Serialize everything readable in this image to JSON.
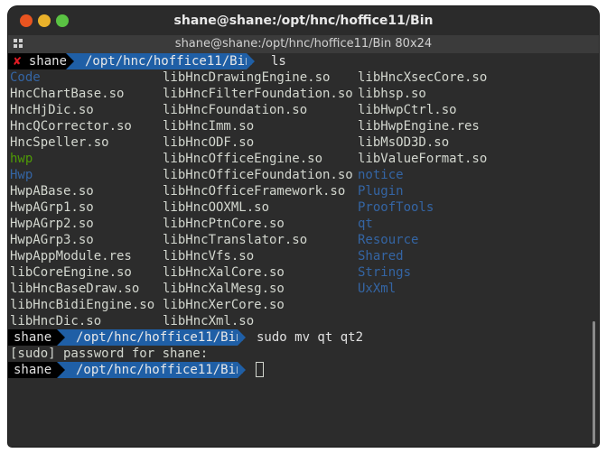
{
  "window": {
    "title": "shane@shane:/opt/hnc/hoffice11/Bin"
  },
  "tab": {
    "title": "shane@shane:/opt/hnc/hoffice11/Bin 80x24"
  },
  "prompt": {
    "user": "shane",
    "error_mark": "✘",
    "path": "/opt/hnc/hoffice11/Bin"
  },
  "commands": {
    "first": "ls",
    "second": "sudo mv qt qt2"
  },
  "sudo_prompt": "[sudo] password for shane:",
  "ls": {
    "col1": [
      {
        "name": "Code",
        "type": "dir"
      },
      {
        "name": "HncChartBase.so",
        "type": "file"
      },
      {
        "name": "HncHjDic.so",
        "type": "file"
      },
      {
        "name": "HncQCorrector.so",
        "type": "file"
      },
      {
        "name": "HncSpeller.so",
        "type": "file"
      },
      {
        "name": "hwp",
        "type": "exec"
      },
      {
        "name": "Hwp",
        "type": "dir"
      },
      {
        "name": "HwpABase.so",
        "type": "file"
      },
      {
        "name": "HwpAGrp1.so",
        "type": "file"
      },
      {
        "name": "HwpAGrp2.so",
        "type": "file"
      },
      {
        "name": "HwpAGrp3.so",
        "type": "file"
      },
      {
        "name": "HwpAppModule.res",
        "type": "file"
      },
      {
        "name": "libCoreEngine.so",
        "type": "file"
      },
      {
        "name": "libHncBaseDraw.so",
        "type": "file"
      },
      {
        "name": "libHncBidiEngine.so",
        "type": "file"
      },
      {
        "name": "libHncDic.so",
        "type": "file"
      }
    ],
    "col2": [
      {
        "name": "libHncDrawingEngine.so",
        "type": "file"
      },
      {
        "name": "libHncFilterFoundation.so",
        "type": "file"
      },
      {
        "name": "libHncFoundation.so",
        "type": "file"
      },
      {
        "name": "libHncImm.so",
        "type": "file"
      },
      {
        "name": "libHncODF.so",
        "type": "file"
      },
      {
        "name": "libHncOfficeEngine.so",
        "type": "file"
      },
      {
        "name": "libHncOfficeFoundation.so",
        "type": "file"
      },
      {
        "name": "libHncOfficeFramework.so",
        "type": "file"
      },
      {
        "name": "libHncOOXML.so",
        "type": "file"
      },
      {
        "name": "libHncPtnCore.so",
        "type": "file"
      },
      {
        "name": "libHncTranslator.so",
        "type": "file"
      },
      {
        "name": "libHncVfs.so",
        "type": "file"
      },
      {
        "name": "libHncXalCore.so",
        "type": "file"
      },
      {
        "name": "libHncXalMesg.so",
        "type": "file"
      },
      {
        "name": "libHncXerCore.so",
        "type": "file"
      },
      {
        "name": "libHncXml.so",
        "type": "file"
      }
    ],
    "col3": [
      {
        "name": "libHncXsecCore.so",
        "type": "file"
      },
      {
        "name": "libhsp.so",
        "type": "file"
      },
      {
        "name": "libHwpCtrl.so",
        "type": "file"
      },
      {
        "name": "libHwpEngine.res",
        "type": "file"
      },
      {
        "name": "libMsOD3D.so",
        "type": "file"
      },
      {
        "name": "libValueFormat.so",
        "type": "file"
      },
      {
        "name": "notice",
        "type": "dir"
      },
      {
        "name": "Plugin",
        "type": "dir"
      },
      {
        "name": "ProofTools",
        "type": "dir"
      },
      {
        "name": "qt",
        "type": "dir"
      },
      {
        "name": "Resource",
        "type": "dir"
      },
      {
        "name": "Shared",
        "type": "dir"
      },
      {
        "name": "Strings",
        "type": "dir"
      },
      {
        "name": "UxXml",
        "type": "dir"
      }
    ]
  },
  "colors": {
    "dir": "#3465a4",
    "exec": "#4e9a06",
    "prompt_path_bg": "#1f5fa6",
    "error_mark": "#e01b24"
  }
}
